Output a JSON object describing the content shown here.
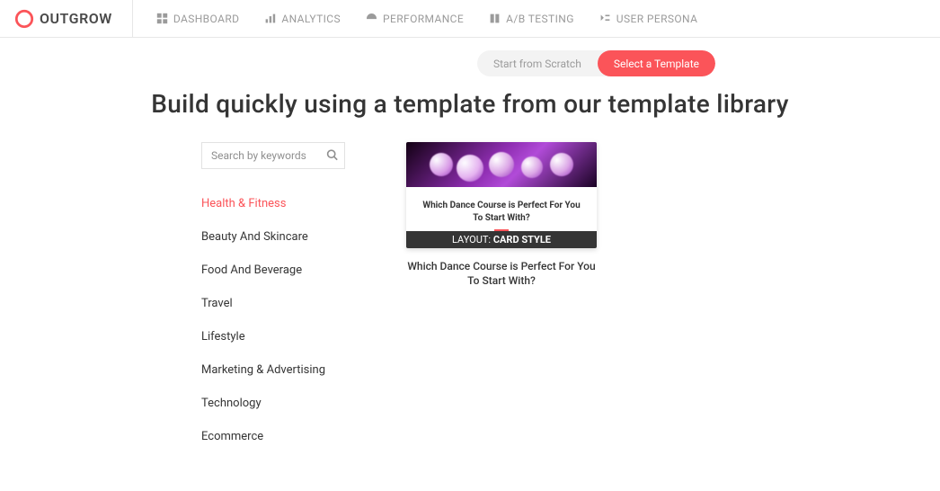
{
  "brand": {
    "name": "OUTGROW",
    "accent": "#fb5459"
  },
  "nav": [
    {
      "label": "DASHBOARD"
    },
    {
      "label": "ANALYTICS"
    },
    {
      "label": "PERFORMANCE"
    },
    {
      "label": "A/B TESTING"
    },
    {
      "label": "USER PERSONA"
    }
  ],
  "toggle": {
    "scratch": "Start from Scratch",
    "template": "Select a Template"
  },
  "title": "Build quickly using a template from our template library",
  "search": {
    "placeholder": "Search by keywords"
  },
  "categories": [
    {
      "label": "Health & Fitness",
      "active": true
    },
    {
      "label": "Beauty And Skincare"
    },
    {
      "label": "Food And Beverage"
    },
    {
      "label": "Travel"
    },
    {
      "label": "Lifestyle"
    },
    {
      "label": "Marketing & Advertising"
    },
    {
      "label": "Technology"
    },
    {
      "label": "Ecommerce"
    }
  ],
  "template_card": {
    "body_text": "Which Dance Course is Perfect For You To Start With?",
    "footer_label": "LAYOUT: ",
    "footer_value": "CARD STYLE",
    "caption": "Which Dance Course is Perfect For You To Start With?"
  }
}
